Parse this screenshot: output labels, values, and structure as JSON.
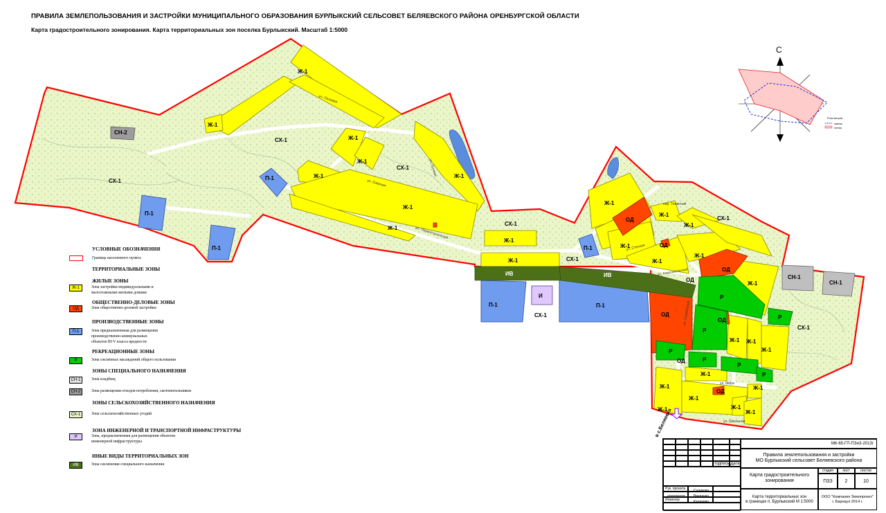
{
  "header": {
    "title": "ПРАВИЛА ЗЕМЛЕПОЛЬЗОВАНИЯ И ЗАСТРОЙКИ МУНИЦИПАЛЬНОГО ОБРАЗОВАНИЯ БУРЛЫКСКИЙ СЕЛЬСОВЕТ БЕЛЯЕВСКОГО РАЙОНА ОРЕНБУРГСКОЙ ОБЛАСТИ",
    "subtitle": "Карта градостроительного зонирования. Карта территориальных зон поселка Бурлыкский.  Масштаб 1:5000"
  },
  "colors": {
    "residential": "#ffff00",
    "business": "#ff4500",
    "industrial": "#6f9cee",
    "recreation": "#00cc00",
    "special": "#bfbfbf",
    "agricultural": "#eaf5c8",
    "infrastructure": "#e0c8ff",
    "greenery": "#4b7018",
    "boundary": "#ff0000"
  },
  "map": {
    "zones": {
      "zh1": "Ж-1",
      "od": "ОД",
      "p1": "П-1",
      "r": "Р",
      "sn1": "СН-1",
      "sn2": "СН-2",
      "sx1": "СХ-1",
      "i": "И",
      "iv": "ИВ"
    },
    "streets": {
      "s1": "ул. Полевая",
      "s2": "ул. Озерная",
      "s3": "ул. Луговая",
      "s4": "ул. Родная",
      "s5": "ул. Новая",
      "s6": "ул. Нефтяников",
      "s7": "пер. Тенистый",
      "s8": "ул. Степная",
      "s9": "ул. Первостроителей",
      "s10": "ул. Комсомольская",
      "s11": "ул. Строителей",
      "s12": "ул. Мира",
      "s13": "ул. Школьная"
    },
    "direction": "в с.Беляевка",
    "compass": {
      "north": "С",
      "legend_title": "Роза ветров",
      "winter": "зимняя",
      "summer": "летняя"
    }
  },
  "legend": {
    "title": "УСЛОВНЫЕ ОБОЗНАЧЕНИЯ",
    "boundary": "Граница населенного пункта",
    "territorial": "ТЕРРИТОРИАЛЬНЫЕ ЗОНЫ",
    "groups": [
      {
        "heading": "ЖИЛЫЕ ЗОНЫ",
        "code": "Ж-1",
        "text": "Зона застройки индивидуальными и\nмалоэтажными жилыми домами",
        "color": "#ffff00"
      },
      {
        "heading": "ОБЩЕСТВЕННО-ДЕЛОВЫЕ ЗОНЫ",
        "code": "ОД",
        "text": "Зона общественно-деловой застройки",
        "color": "#ff4500"
      },
      {
        "heading": "ПРОИЗВОДСТВЕННЫЕ ЗОНЫ",
        "code": "П-1",
        "text": "Зона предназначенная для размещения\n производственно-коммунальных\n объектов III-V класса вредности",
        "color": "#6f9cee"
      },
      {
        "heading": "РЕКРЕАЦИОННЫЕ ЗОНЫ",
        "code": "Р",
        "text": "Зона озеленных насаждений общего пользования",
        "color": "#00cc00"
      },
      {
        "heading": "ЗОНЫ СПЕЦИАЛЬНОГО НАЗНАЧЕНИЯ",
        "code": "СН-1",
        "text": "Зона кладбищ",
        "color": "#e6e6e6"
      },
      {
        "heading": "",
        "code": "СН-2",
        "text": "Зона размещения отходов потребления, скотомогильников",
        "color": "#9c9c9c"
      },
      {
        "heading": "ЗОНЫ СЕЛЬСКОХОЗЯЙСТВЕННОГО  НАЗНАЧЕНИЯ",
        "code": "СХ-1",
        "text": "Зона сельскохозяйственных угодий",
        "color": "#eaf5c8"
      },
      {
        "heading": "ЗОНА ИНЖЕНЕРНОЙ И ТРАНСПОРТНОЙ ИНФРАСТРУКТУРЫ",
        "code": "И",
        "text": "Зона, предназначенная для размещения объектов\n инженерной инфраструктуры",
        "color": "#e0c8ff"
      },
      {
        "heading": "ИНЫЕ ВИДЫ ТЕРРИТОРИАЛЬНЫХ  ЗОН",
        "code": "ИВ",
        "text": "Зона озеленения специального назначения",
        "color": "#4b7018"
      }
    ]
  },
  "stamp": {
    "code": "МК-65-ГП-ПЗиЗ-2013г",
    "project": "Правила землепользования и застройки\nМО Бурлыкский сельсовет Беляевского района",
    "sheet_title": "Карта градостроительного\nзонирования",
    "drawing": "Карта территориальных зон\nв границах п. Бурлыкский М 1:5000",
    "company": "ООО \"Компания Землпроект\"\nг. Барнаул 2014 г.",
    "col_stage": "стадия",
    "col_sheet": "лист",
    "col_sheets": "листов",
    "stage": "ПЗЗ",
    "sheet": "2",
    "sheets": "10",
    "sign": "Подпись",
    "date": "Дата",
    "roles": [
      "Рук. проекта",
      "Гл. архитектор",
      "Инженер"
    ],
    "names": [
      "Г. А. Садикова",
      "Е.Ю Вячланко",
      "Т.А. Калачева"
    ]
  }
}
